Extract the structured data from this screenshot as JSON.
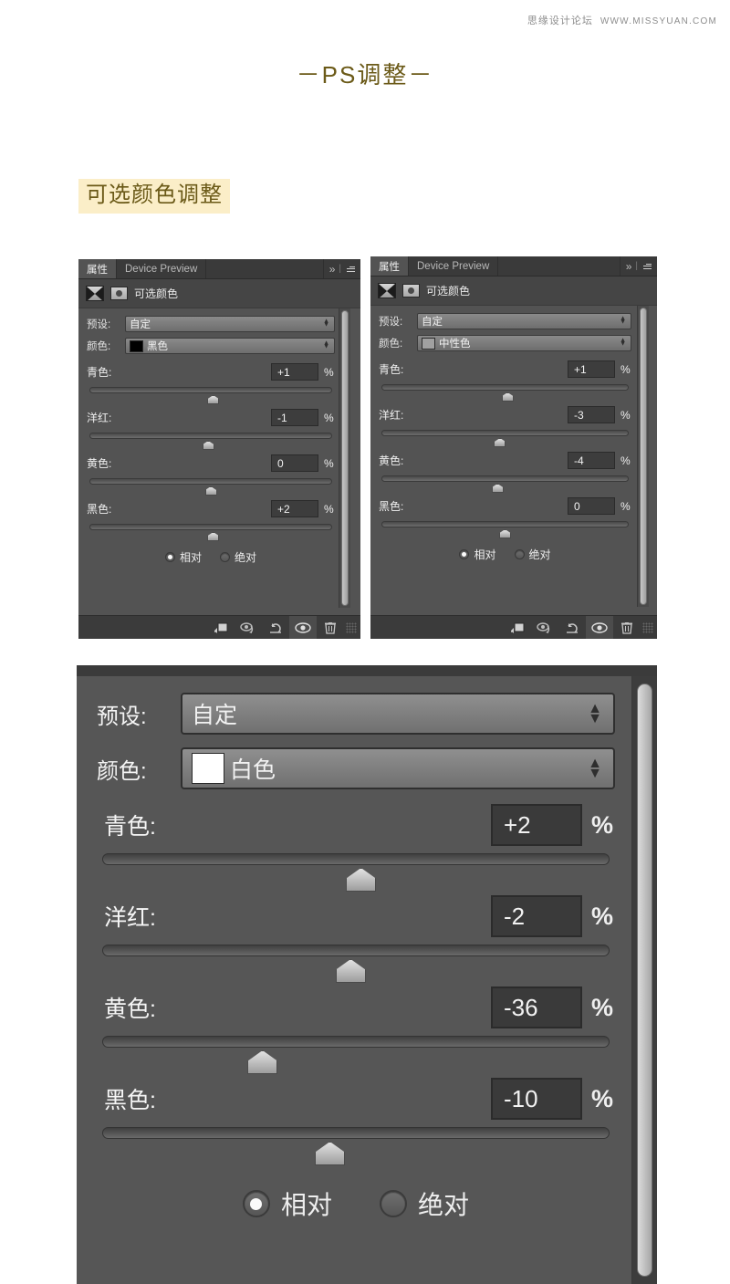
{
  "watermark": {
    "cn": "思缘设计论坛",
    "en": "WWW.MISSYUAN.COM"
  },
  "page": {
    "title": "－PS调整－",
    "section_label": "可选颜色调整",
    "title_color": "#6b5a18",
    "highlight_color": "#fbeec8"
  },
  "panels": [
    {
      "id": "panel1",
      "tabs": [
        {
          "label": "属性",
          "active": true
        },
        {
          "label": "Device Preview",
          "active": false
        }
      ],
      "tab_icons": {
        "collapse": "»",
        "separator": "|",
        "menu": "menu-icon"
      },
      "header_title": "可选颜色",
      "preset": {
        "label": "预设:",
        "value": "自定"
      },
      "color": {
        "label": "颜色:",
        "value": "黑色",
        "swatch": "#000000"
      },
      "sliders": [
        {
          "label": "青色:",
          "value": "+1",
          "unit": "%",
          "pos": 51
        },
        {
          "label": "洋红:",
          "value": "-1",
          "unit": "%",
          "pos": 49
        },
        {
          "label": "黄色:",
          "value": "0",
          "unit": "%",
          "pos": 50
        },
        {
          "label": "黑色:",
          "value": "+2",
          "unit": "%",
          "pos": 51
        }
      ],
      "method": {
        "relative": {
          "label": "相对",
          "selected": true
        },
        "absolute": {
          "label": "绝对",
          "selected": false
        }
      },
      "footer_icons": [
        "clip-to-layer-icon",
        "view-previous-state-icon",
        "reset-icon",
        "toggle-visibility-icon",
        "delete-icon"
      ],
      "footer_active_index": 3
    },
    {
      "id": "panel2",
      "tabs": [
        {
          "label": "属性",
          "active": true
        },
        {
          "label": "Device Preview",
          "active": false
        }
      ],
      "tab_icons": {
        "collapse": "»",
        "separator": "|",
        "menu": "menu-icon"
      },
      "header_title": "可选颜色",
      "preset": {
        "label": "预设:",
        "value": "自定"
      },
      "color": {
        "label": "颜色:",
        "value": "中性色",
        "swatch": "#a0a0a0"
      },
      "sliders": [
        {
          "label": "青色:",
          "value": "+1",
          "unit": "%",
          "pos": 51
        },
        {
          "label": "洋红:",
          "value": "-3",
          "unit": "%",
          "pos": 48
        },
        {
          "label": "黄色:",
          "value": "-4",
          "unit": "%",
          "pos": 47
        },
        {
          "label": "黑色:",
          "value": "0",
          "unit": "%",
          "pos": 50
        }
      ],
      "method": {
        "relative": {
          "label": "相对",
          "selected": true
        },
        "absolute": {
          "label": "绝对",
          "selected": false
        }
      },
      "footer_icons": [
        "clip-to-layer-icon",
        "view-previous-state-icon",
        "reset-icon",
        "toggle-visibility-icon",
        "delete-icon"
      ],
      "footer_active_index": 3
    }
  ],
  "panel3": {
    "preset": {
      "label": "预设:",
      "value": "自定"
    },
    "color": {
      "label": "颜色:",
      "value": "白色",
      "swatch": "#ffffff"
    },
    "sliders": [
      {
        "label": "青色:",
        "value": "+2",
        "unit": "%",
        "pos": 51
      },
      {
        "label": "洋红:",
        "value": "-2",
        "unit": "%",
        "pos": 49
      },
      {
        "label": "黄色:",
        "value": "-36",
        "unit": "%",
        "pos": 32
      },
      {
        "label": "黑色:",
        "value": "-10",
        "unit": "%",
        "pos": 45
      }
    ],
    "method": {
      "relative": {
        "label": "相对",
        "selected": true
      },
      "absolute": {
        "label": "绝对",
        "selected": false
      }
    }
  }
}
